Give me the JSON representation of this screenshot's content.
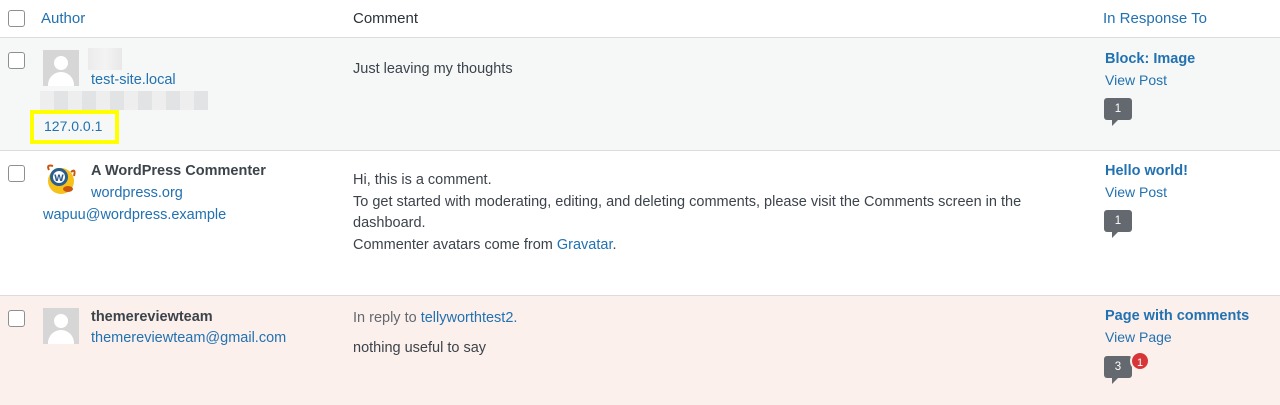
{
  "header": {
    "author": "Author",
    "comment": "Comment",
    "in_response_to": "In Response To"
  },
  "rows": [
    {
      "author_url": "test-site.local",
      "ip": "127.0.0.1",
      "comment": "Just leaving my thoughts",
      "post_title": "Block: Image",
      "view_label": "View Post",
      "approved_count": "1"
    },
    {
      "author_name": "A WordPress Commenter",
      "author_url": "wordpress.org",
      "author_email": "wapuu@wordpress.example",
      "comment_line1": "Hi, this is a comment.",
      "comment_line2": "To get started with moderating, editing, and deleting comments, please visit the Comments screen in the",
      "comment_line3": "dashboard.",
      "comment_line4_prefix": "Commenter avatars come from ",
      "comment_line4_link": "Gravatar",
      "comment_line4_suffix": ".",
      "post_title": "Hello world!",
      "view_label": "View Post",
      "approved_count": "1"
    },
    {
      "author_name": "themereviewteam",
      "author_email": "themereviewteam@gmail.com",
      "reply_prefix": "In reply to ",
      "reply_link": "tellyworthtest2.",
      "comment": "nothing useful to say",
      "post_title": "Page with comments",
      "view_label": "View Page",
      "approved_count": "3",
      "pending_count": "1"
    }
  ],
  "colors": {
    "link": "#2271b1",
    "pending_row_bg": "#fcf0ec",
    "highlight_box": "#ffff00",
    "pending_badge": "#d63638"
  },
  "icons": [
    "checkbox-icon",
    "default-avatar-icon",
    "wapuu-avatar-icon",
    "comment-bubble-icon"
  ]
}
